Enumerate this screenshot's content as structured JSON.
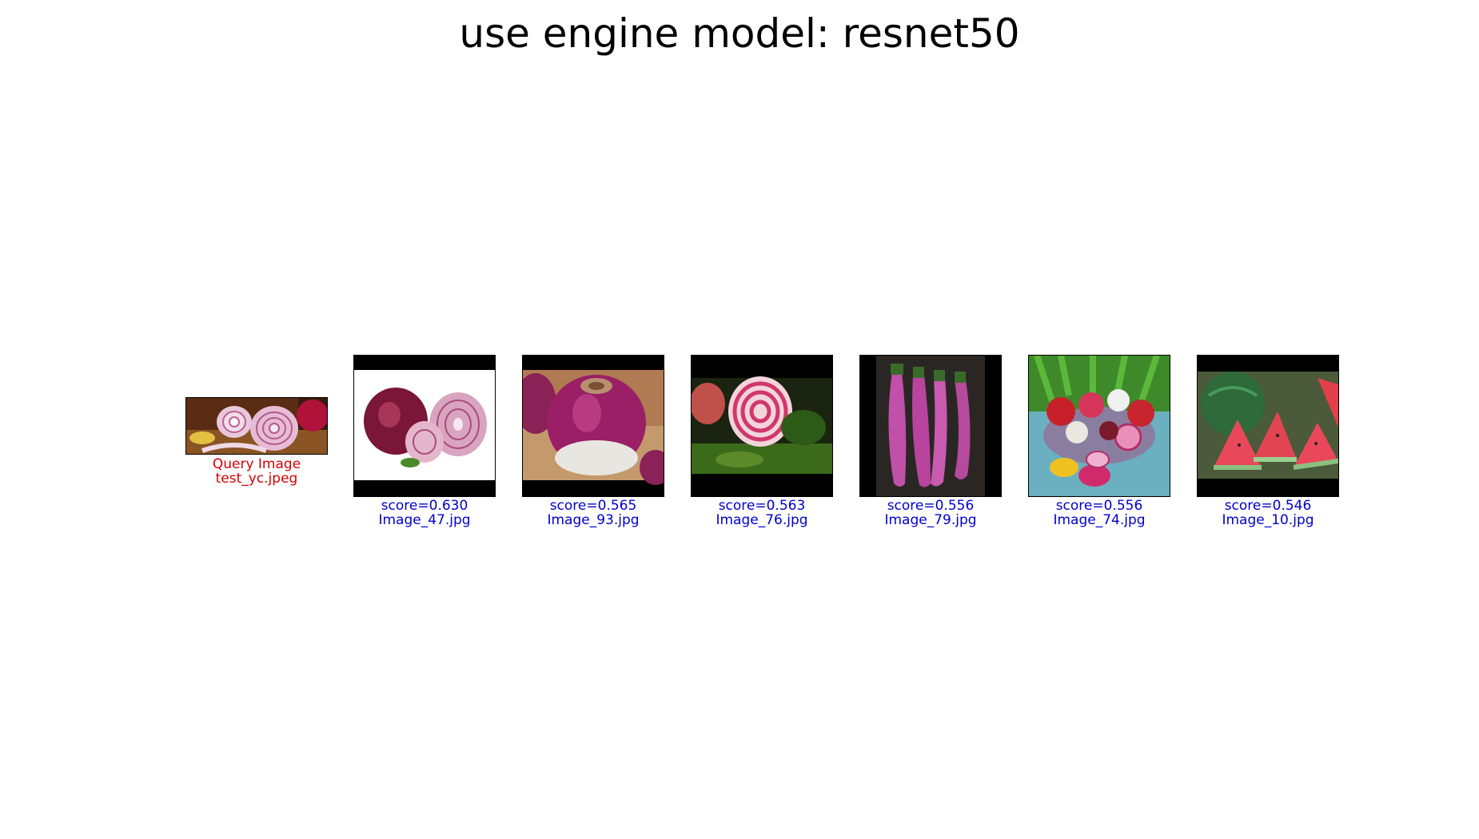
{
  "title": "use engine model: resnet50",
  "colors": {
    "query_text": "#d40000",
    "result_text": "#0000cc"
  },
  "query": {
    "label": "Query Image",
    "filename": "test_yc.jpeg",
    "picture": "sliced red onion on wooden board"
  },
  "results": [
    {
      "score_text": "score=0.630",
      "filename": "Image_47.jpg",
      "picture": "red onion halves on white"
    },
    {
      "score_text": "score=0.565",
      "filename": "Image_93.jpg",
      "picture": "purple turnip"
    },
    {
      "score_text": "score=0.563",
      "filename": "Image_76.jpg",
      "picture": "chioggia beet slice"
    },
    {
      "score_text": "score=0.556",
      "filename": "Image_79.jpg",
      "picture": "purple eggplants"
    },
    {
      "score_text": "score=0.556",
      "filename": "Image_74.jpg",
      "picture": "basket of beets and radishes"
    },
    {
      "score_text": "score=0.546",
      "filename": "Image_10.jpg",
      "picture": "watermelon slices"
    }
  ]
}
